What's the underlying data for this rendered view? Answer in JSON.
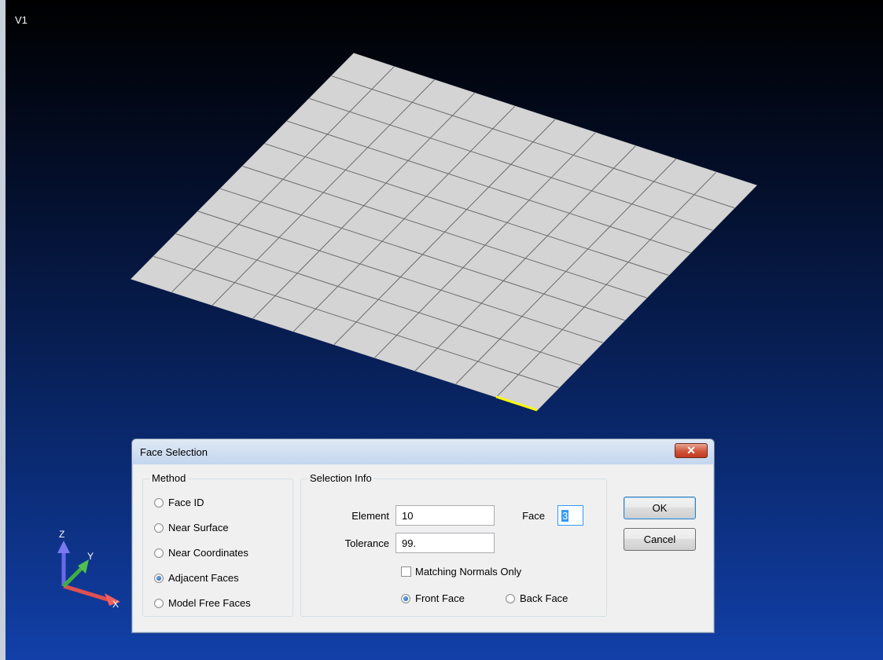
{
  "viewport": {
    "label": "V1",
    "triad": {
      "x_label": "X",
      "y_label": "Y",
      "z_label": "Z"
    }
  },
  "dialog": {
    "title": "Face Selection",
    "close_label": "✕",
    "method": {
      "title": "Method",
      "options": [
        {
          "label": "Face ID",
          "checked": false
        },
        {
          "label": "Near Surface",
          "checked": false
        },
        {
          "label": "Near Coordinates",
          "checked": false
        },
        {
          "label": "Adjacent Faces",
          "checked": true
        },
        {
          "label": "Model Free Faces",
          "checked": false
        }
      ]
    },
    "selection_info": {
      "title": "Selection Info",
      "element_label": "Element",
      "element_value": "10",
      "face_label": "Face",
      "face_value": "3",
      "tolerance_label": "Tolerance",
      "tolerance_value": "99.",
      "matching_normals_label": "Matching Normals Only",
      "matching_normals_checked": false,
      "front_face_label": "Front Face",
      "front_face_checked": true,
      "back_face_label": "Back Face",
      "back_face_checked": false
    },
    "ok_label": "OK",
    "cancel_label": "Cancel"
  }
}
